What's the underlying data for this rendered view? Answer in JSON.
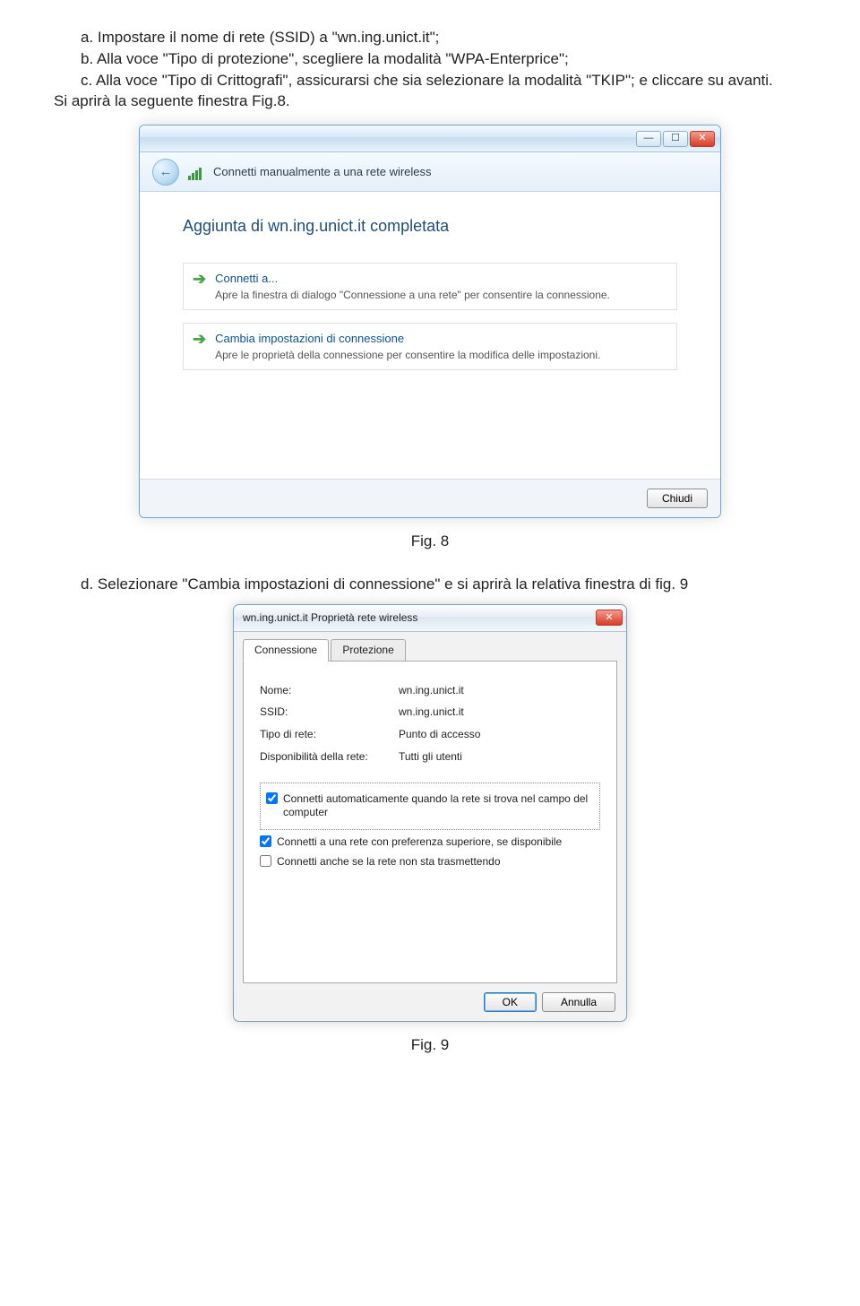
{
  "text": {
    "line_a": "a. Impostare il nome di rete (SSID) a \"wn.ing.unict.it\";",
    "line_b": "b. Alla voce \"Tipo di protezione\", scegliere la modalità \"WPA-Enterprice\";",
    "line_c": "c. Alla voce \"Tipo di Crittografi\", assicurarsi che sia selezionare la modalità \"TKIP\"; e cliccare su avanti.",
    "line_after_c": "Si aprirà la seguente finestra Fig.8.",
    "fig8_caption": "Fig. 8",
    "line_d": "d. Selezionare \"Cambia impostazioni di connessione\" e si aprirà la relativa finestra di fig. 9",
    "fig9_caption": "Fig. 9"
  },
  "fig8": {
    "toolbar_text": "Connetti manualmente a una rete wireless",
    "heading": "Aggiunta di wn.ing.unict.it completata",
    "link1_title": "Connetti a...",
    "link1_sub": "Apre la finestra di dialogo \"Connessione a una rete\" per consentire la connessione.",
    "link2_title": "Cambia impostazioni di connessione",
    "link2_sub": "Apre le proprietà della connessione per consentire la modifica delle impostazioni.",
    "close_btn": "Chiudi"
  },
  "fig9": {
    "title": "wn.ing.unict.it Proprietà rete wireless",
    "tab1": "Connessione",
    "tab2": "Protezione",
    "rows": {
      "nome_l": "Nome:",
      "nome_v": "wn.ing.unict.it",
      "ssid_l": "SSID:",
      "ssid_v": "wn.ing.unict.it",
      "tipo_l": "Tipo di rete:",
      "tipo_v": "Punto di accesso",
      "disp_l": "Disponibilità della rete:",
      "disp_v": "Tutti gli utenti"
    },
    "chk1": "Connetti automaticamente quando la rete si trova nel campo del computer",
    "chk2": "Connetti a una rete con preferenza superiore, se disponibile",
    "chk3": "Connetti anche se la rete non sta trasmettendo",
    "ok": "OK",
    "cancel": "Annulla"
  }
}
